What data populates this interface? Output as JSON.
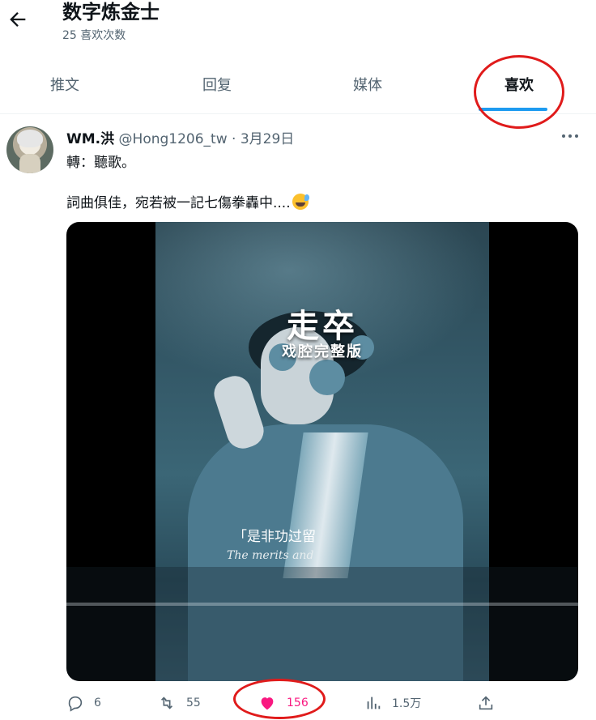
{
  "header": {
    "title": "数字炼金士",
    "subtitle": "25 喜欢次数"
  },
  "tabs": [
    {
      "label": "推文",
      "active": false
    },
    {
      "label": "回复",
      "active": false
    },
    {
      "label": "媒体",
      "active": false
    },
    {
      "label": "喜欢",
      "active": true
    }
  ],
  "tweet": {
    "author_name": "WM.洪",
    "author_handle": "@Hong1206_tw",
    "separator": "·",
    "date": "3月29日",
    "text_line1": "轉：聽歌。",
    "text_line2": "詞曲俱佳，宛若被一記七傷拳轟中....",
    "emoji": "sweat-smile-emoji",
    "media": {
      "title": "走卒",
      "subtitle": "戏腔完整版",
      "lyric_cn": "「是非功过留",
      "lyric_en": "The merits and"
    },
    "actions": {
      "reply_count": "6",
      "retweet_count": "55",
      "like_count": "156",
      "views_count": "1.5万"
    }
  },
  "colors": {
    "accent": "#1d9bf0",
    "like": "#f91880",
    "annotation": "#e01b1b",
    "secondary_text": "#536471"
  }
}
